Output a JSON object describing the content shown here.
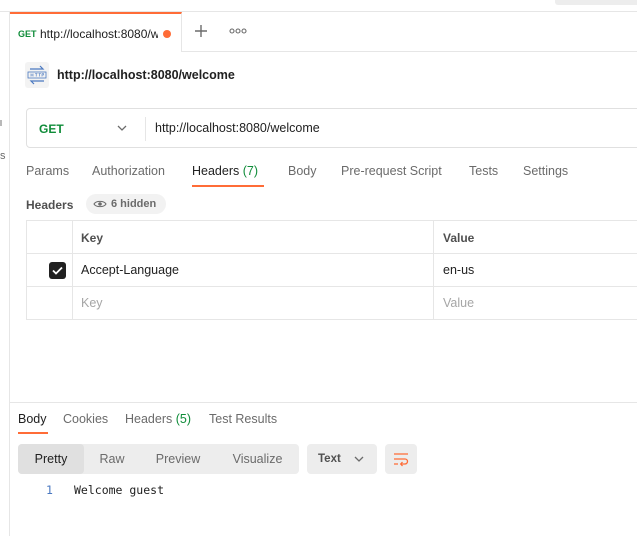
{
  "tab": {
    "method": "GET",
    "url": "http://localhost:8080/w"
  },
  "page": {
    "title": "http://localhost:8080/welcome"
  },
  "request": {
    "method": "GET",
    "url": "http://localhost:8080/welcome"
  },
  "request_tabs": {
    "params": "Params",
    "authorization": "Authorization",
    "headers": "Headers",
    "headers_count": "(7)",
    "body": "Body",
    "prerequest": "Pre-request Script",
    "tests": "Tests",
    "settings": "Settings"
  },
  "headers_section": {
    "label": "Headers",
    "hidden": "6 hidden"
  },
  "table": {
    "col_key": "Key",
    "col_value": "Value",
    "rows": [
      {
        "key": "Accept-Language",
        "value": "en-us",
        "checked": true
      }
    ],
    "placeholder_key": "Key",
    "placeholder_value": "Value"
  },
  "response_tabs": {
    "body": "Body",
    "cookies": "Cookies",
    "headers": "Headers",
    "headers_count": "(5)",
    "results": "Test Results"
  },
  "view_modes": {
    "pretty": "Pretty",
    "raw": "Raw",
    "preview": "Preview",
    "visualize": "Visualize"
  },
  "format": "Text",
  "body_output": {
    "line": "1",
    "text": "Welcome guest"
  },
  "colors": {
    "accent": "#ff6c37",
    "method_get": "#0f8c39"
  },
  "icons": [
    "plus-icon",
    "more-icon",
    "http-icon",
    "chevron-down-icon",
    "eye-icon",
    "check-icon",
    "wrap-lines-icon"
  ]
}
